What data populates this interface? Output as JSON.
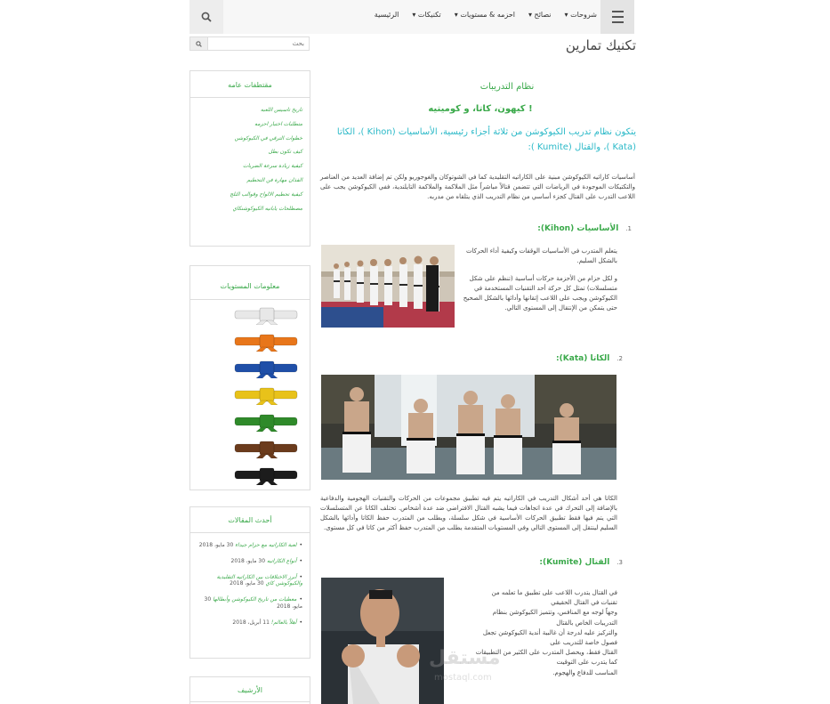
{
  "nav": {
    "menu_items": [
      "الرئيسية",
      "تكنيكات ▾",
      "احزمه & مستويات ▾",
      "نصائح ▾",
      "شروحات ▾"
    ]
  },
  "search": {
    "placeholder": "بحث"
  },
  "widgets": {
    "general": {
      "title": "مقتطفات عامه",
      "items": [
        "تاريخ تاسيس اللعبه",
        "متطلبات اختبار احزمه",
        "خطوات الترقي في الكيوكوشن",
        "كيف تكون بطل",
        "كيفية زيادة سرعة الضربات",
        "الفذان مهارة فن التحطيم",
        "كيفية تحطيم الالواح وقوالب الثلج",
        "مصطلحات يابانيه الكيوكوشنكاي"
      ]
    },
    "levels": {
      "title": "معلومات المستويات",
      "belt_colors": [
        "#e8e8e8",
        "#e8761a",
        "#1f4fa8",
        "#e8c21a",
        "#2f8a2a",
        "#6b3b1c",
        "#1c1c1c"
      ]
    },
    "recent": {
      "title": "أحدث المقالات",
      "posts": [
        {
          "link": "لعبة الكاراتيه مع حزام جيداء",
          "date": "30 مايو، 2018"
        },
        {
          "link": "أنواع الكاراتيه",
          "date": "30 مايو، 2018"
        },
        {
          "link": "أبرز الاختلافات بين الكاراتيه التقليدية والكيوكوشن كاي",
          "date": "30 مايو، 2018"
        },
        {
          "link": "معطيات من تاريخ الكيوكوشن وأبطالها",
          "date": "30 مايو، 2018"
        },
        {
          "link": "أهلاً بالعالم!",
          "date": "11 أبريل، 2018"
        }
      ]
    },
    "archive": {
      "title": "الأرشيف"
    }
  },
  "main": {
    "page_title": "تكنيك تمارين",
    "section_title": "نظام التدريبات",
    "subtitle": "كيهون، كاتا، و كوميتيه !",
    "intro": "يتكون نظام تدريب الكيوكوشن من ثلاثة أجزاء رئيسية، الأساسيات (Kihon )، الكاتا (Kata )، والقتال (Kumite ):",
    "para_intro": "أساسيات كاراتيه الكيوكوشن مبنية على الكاراتيه التقليدية كما في الشوتوكان والغوجوريو ولكن تم إضافة العديد من العناصر والتكتيكات الموجودة في الرياضات التي تتضمن قتالاً مباشراً مثل الملاكمة والملاكمة التايلندية، ففي الكيوكوشن يجب على اللاعب التدرب على القتال كجزء أساسي من نظام التدريب الذي يتلقاه من مدربه.",
    "kihon_heading": "الأساسيات (Kihon):",
    "kihon_num": "1.",
    "kihon_p1": "يتعلم المتدرب في الأساسيات الوقفات وكيفية أداء الحركات بالشكل السليم.",
    "kihon_p2": "و لكل حزام من الأحزمة حركات أساسية (تنظم على شكل متسلسلات) تمثل كل حركة أحد التقنيات المستخدمة في الكيوكوشن ويجب على اللاعب إتقانها وأدائها بالشكل الصحيح حتى يتمكن من الإنتقال إلى المستوى التالي.",
    "kata_heading": "الكاتا (Kata):",
    "kata_num": "2.",
    "kata_p": "الكاتا هي أحد أشكال التدريب في الكاراتيه يتم فيه تطبيق مجموعات من الحركات والتقنيات الهجومية والدفاعية بالإضافة إلى التحرك في عدة اتجاهات فيما يشبه القتال الافتراضي ضد عدة أشخاص. تختلف الكاتا عن المتسلسلات التي يتم فيها فقط تطبيق الحركات الأساسية في شكل سلسلة، ويطلب من المتدرب حفظ الكاتا وأدائها بالشكل السليم لينتقل إلى المستوى التالي وفي المستويات المتقدمة يطلب من المتدرب حفظ أكثر من كاتا في كل مستوى.",
    "kumite_heading": "القتال (Kumite):",
    "kumite_num": "3.",
    "kumite_lines": [
      "في القتال يتدرب اللاعب على تطبيق ما تعلمه من",
      "تقنيات في القتال الحقيقي",
      "وجهاً لوجه مع المنافس، وتتميز الكيوكوشن بنظام",
      "التدريبات الخاص بالقتال",
      "والتركيز عليه لدرجة أن غالبية أندية الكيوكوشن تجعل",
      "فصول خاصة للتدريب على",
      "القتال فقط، ويحصل المتدرب على الكثير من التطبيقات",
      "كما يتدرب على التوقيت",
      "المناسب للدفاع والهجوم."
    ],
    "watermark": "مستقل",
    "watermark_sub": "mostaql.com"
  }
}
